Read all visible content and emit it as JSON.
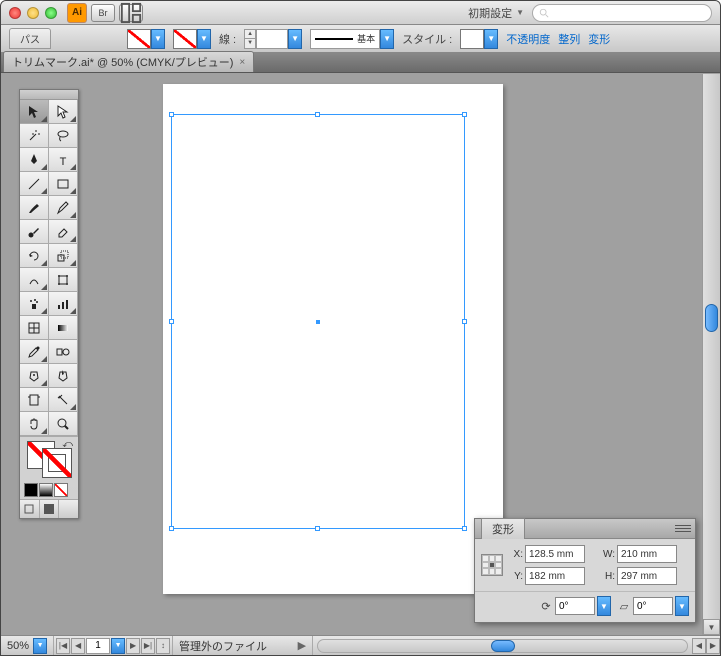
{
  "titlebar": {
    "app_abbrev": "Ai",
    "bridge_btn": "Br",
    "preset_label": "初期設定",
    "search_placeholder": ""
  },
  "controlbar": {
    "tab_label": "パス",
    "stroke_label": "線 :",
    "stroke_weight": "",
    "stroke_style_label": "基本",
    "style_label": "スタイル :",
    "links": {
      "opacity": "不透明度",
      "align": "整列",
      "transform": "変形"
    }
  },
  "doc_tab": {
    "title": "トリムマーク.ai* @ 50% (CMYK/プレビュー)"
  },
  "transform": {
    "title": "変形",
    "x_label": "X:",
    "x_value": "128.5 mm",
    "y_label": "Y:",
    "y_value": "182 mm",
    "w_label": "W:",
    "w_value": "210 mm",
    "h_label": "H:",
    "h_value": "297 mm",
    "rotate_value": "0°",
    "shear_value": "0°"
  },
  "statusbar": {
    "zoom": "50%",
    "page": "1",
    "status_text": "管理外のファイル"
  }
}
